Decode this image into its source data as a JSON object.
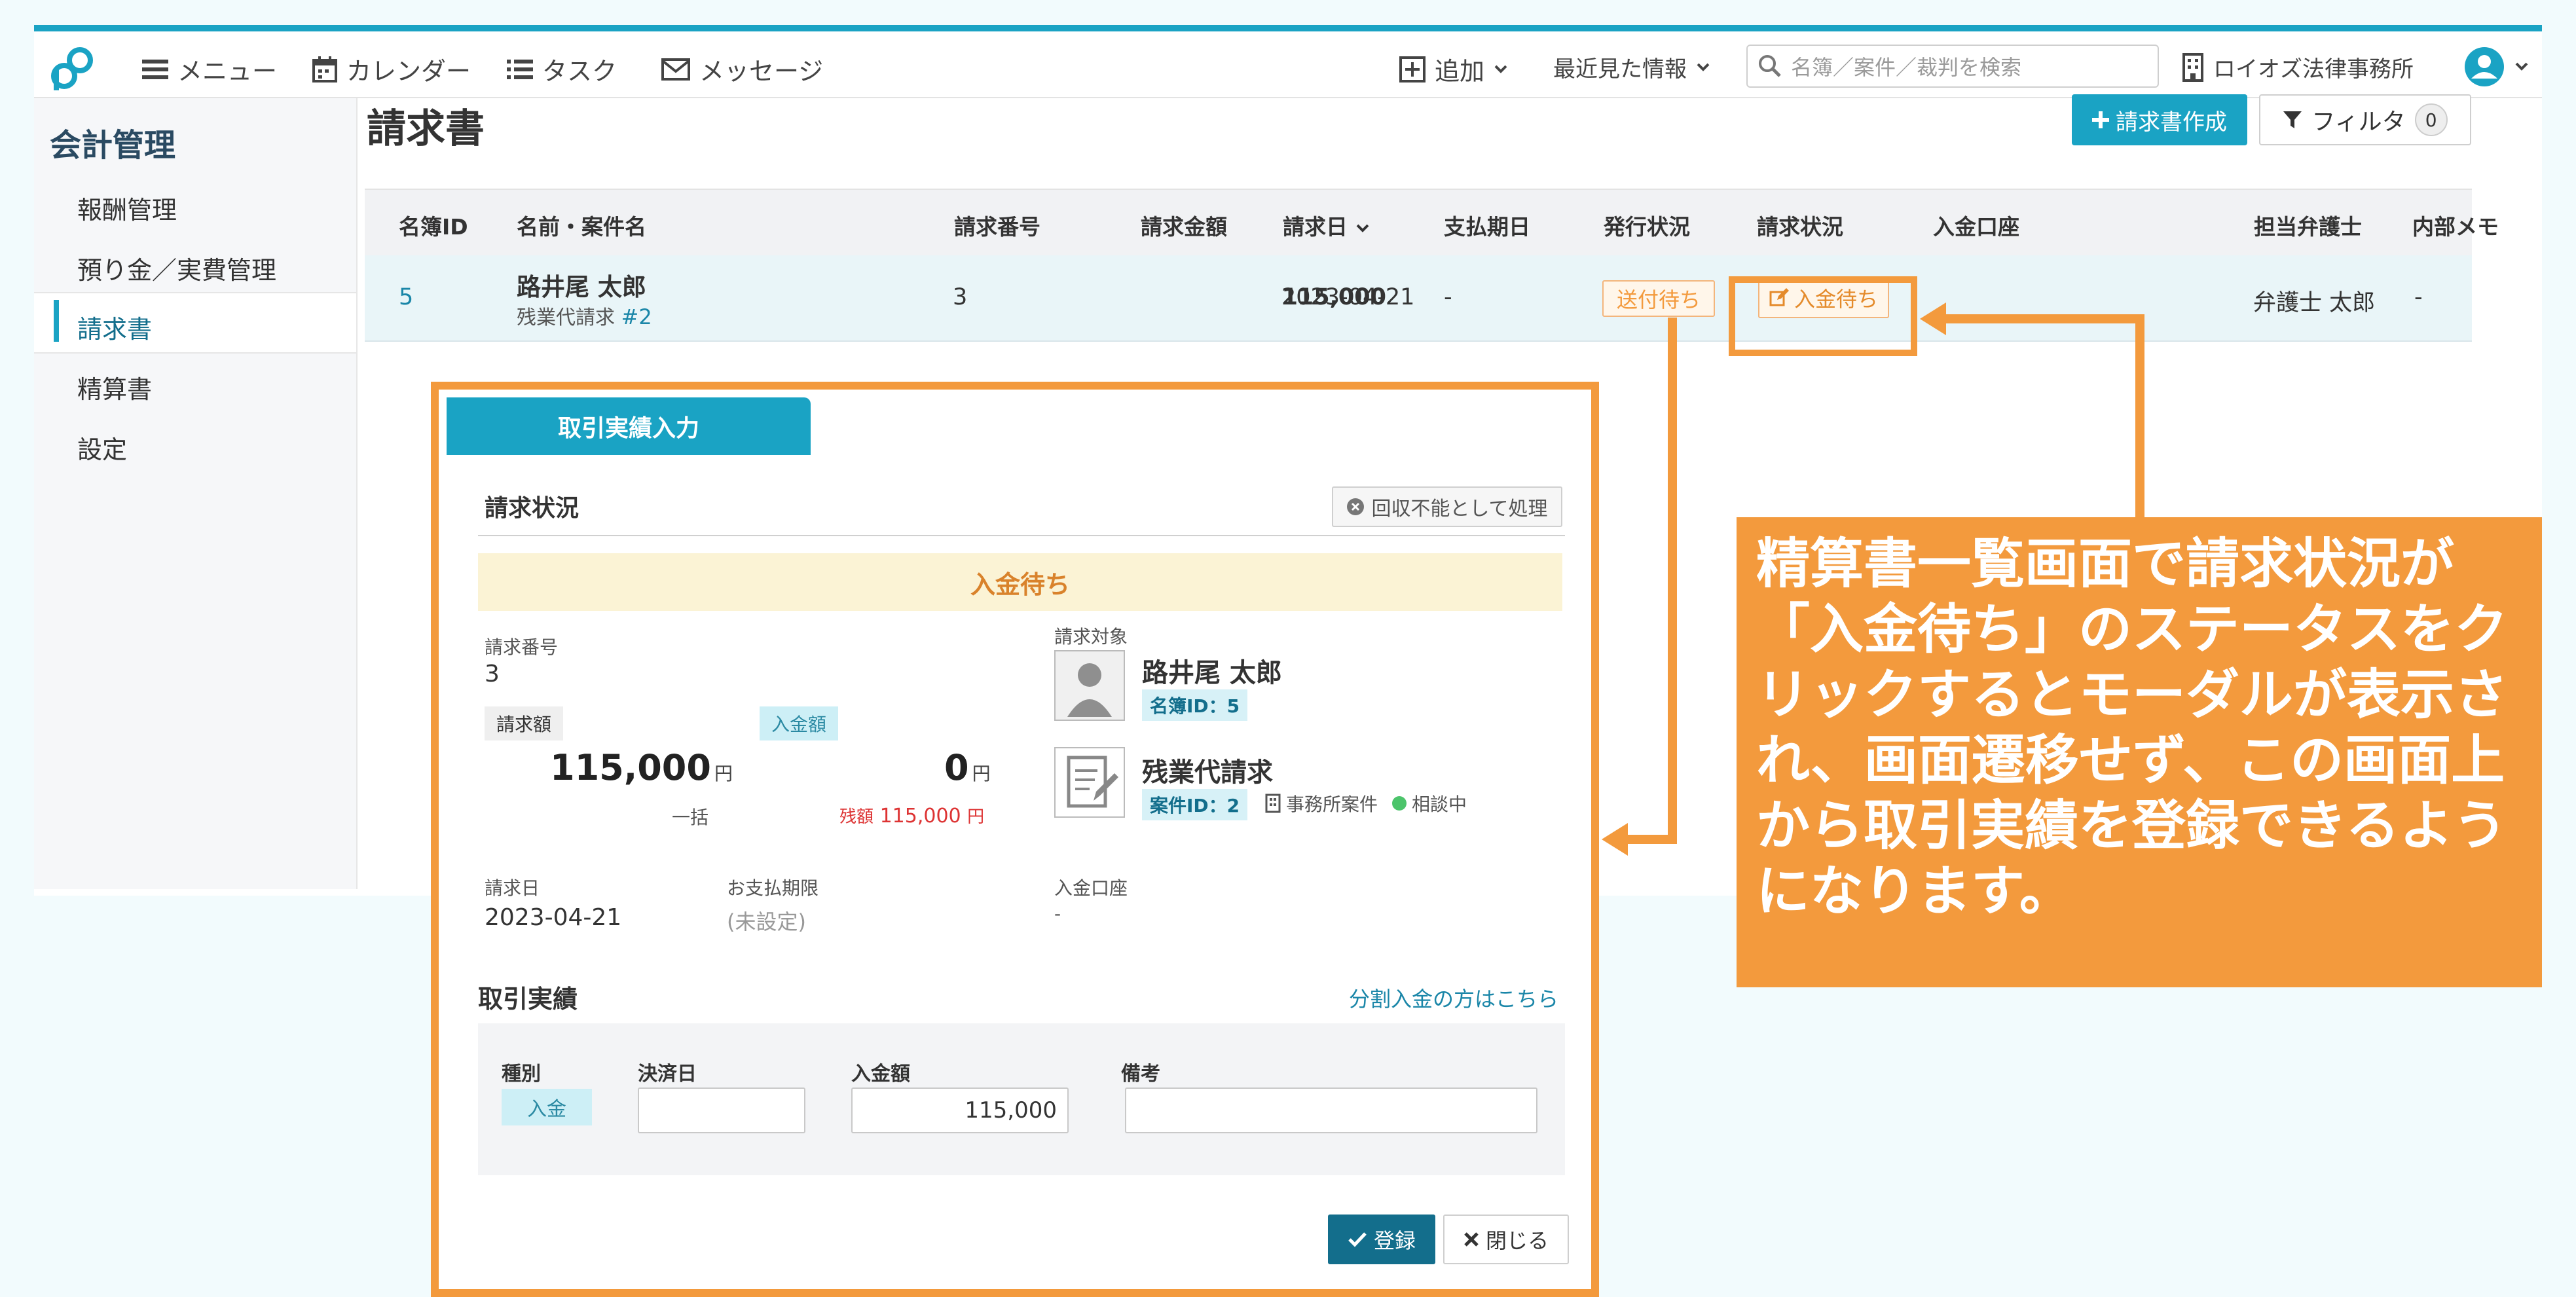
{
  "topbar": {
    "menu": "メニュー",
    "calendar": "カレンダー",
    "task": "タスク",
    "message": "メッセージ",
    "add": "追加",
    "recent": "最近見た情報",
    "search_placeholder": "名簿／案件／裁判を検索",
    "office": "ロイオズ法律事務所"
  },
  "sidebar": {
    "title": "会計管理",
    "items": [
      "報酬管理",
      "預り金／実費管理",
      "請求書",
      "精算書",
      "設定"
    ]
  },
  "page": {
    "title": "請求書",
    "create_button": "請求書作成",
    "filter_button": "フィルタ",
    "filter_count": "0"
  },
  "table": {
    "headers": [
      "名簿ID",
      "名前・案件名",
      "請求番号",
      "請求金額",
      "請求日",
      "支払期日",
      "発行状況",
      "請求状況",
      "入金口座",
      "担当弁護士",
      "内部メモ"
    ],
    "row": {
      "id": "5",
      "name": "路井尾 太郎",
      "case": "残業代請求",
      "case_no": "#2",
      "invoice_no": "3",
      "amount": "115,000",
      "date": "2023-04-21",
      "due": "-",
      "issue_status": "送付待ち",
      "bill_status": "入金待ち",
      "account": "",
      "lawyer": "弁護士 太郎",
      "memo": "-"
    }
  },
  "modal": {
    "tab": "取引実績入力",
    "section_status": "請求状況",
    "uncollectable_button": "回収不能として処理",
    "status_banner": "入金待ち",
    "invoice_no_label": "請求番号",
    "invoice_no": "3",
    "billed_label": "請求額",
    "billed_amount": "115,000",
    "yen": "円",
    "lump": "一括",
    "received_label": "入金額",
    "received_amount": "0",
    "remaining_label": "残額",
    "remaining_amount": "115,000",
    "target_label": "請求対象",
    "target_name": "路井尾 太郎",
    "target_id": "名簿ID：5",
    "case_name": "残業代請求",
    "case_id": "案件ID：2",
    "office_case": "事務所案件",
    "consulting": "相談中",
    "date_label": "請求日",
    "date": "2023-04-21",
    "due_label": "お支払期限",
    "due": "(未設定)",
    "account_label": "入金口座",
    "account": "-",
    "trans_title": "取引実績",
    "split_link": "分割入金の方はこちら",
    "col_type": "種別",
    "col_date": "決済日",
    "col_amount": "入金額",
    "col_note": "備考",
    "type_value": "入金",
    "amount_value": "115,000",
    "register": "登録",
    "close": "閉じる"
  },
  "callout": {
    "lines": [
      "精算書一覧画面で請求状況が",
      "「入金待ち」のステータスをク",
      "リックするとモーダルが表示さ",
      "れ、画面遷移せず、この画面上",
      "から取引実績を登録できるよう",
      "になります。"
    ]
  },
  "colors": {
    "accent": "#1aa3c4",
    "highlight": "#f39a3d",
    "dark_teal": "#136e8c"
  }
}
